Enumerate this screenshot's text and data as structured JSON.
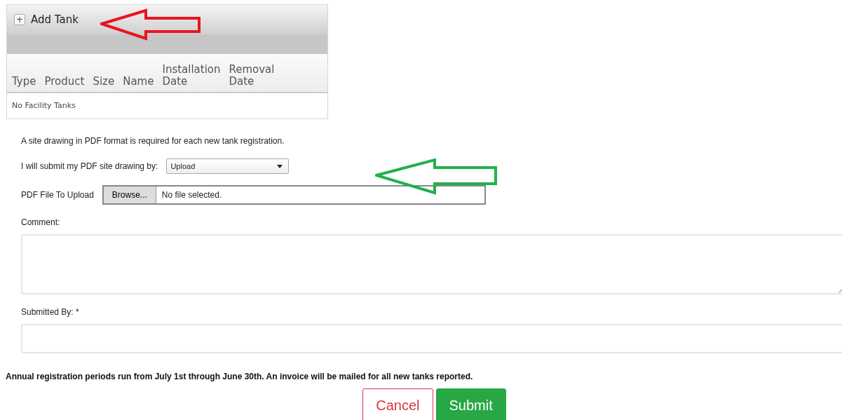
{
  "panel": {
    "add_button": "+",
    "title": "Add Tank"
  },
  "table": {
    "columns": [
      "Type",
      "Product",
      "Size",
      "Name",
      "Installation Date",
      "Removal Date"
    ],
    "empty_message": "No Facility Tanks"
  },
  "form": {
    "notice": "A site drawing in PDF format is required for each new tank registration.",
    "method_label": "I will submit my PDF site drawing by:",
    "method_value": "Upload",
    "file_label": "PDF File To Upload",
    "browse_button": "Browse...",
    "file_status": "No file selected.",
    "comment_label": "Comment:",
    "submitted_by_label": "Submitted By: *"
  },
  "footer_note": "Annual registration periods run from July 1st through June 30th. An invoice will be mailed for all new tanks reported.",
  "buttons": [
    {
      "label": "Cancel",
      "kind": "outline"
    },
    {
      "label": "Submit",
      "kind": "solid"
    }
  ]
}
